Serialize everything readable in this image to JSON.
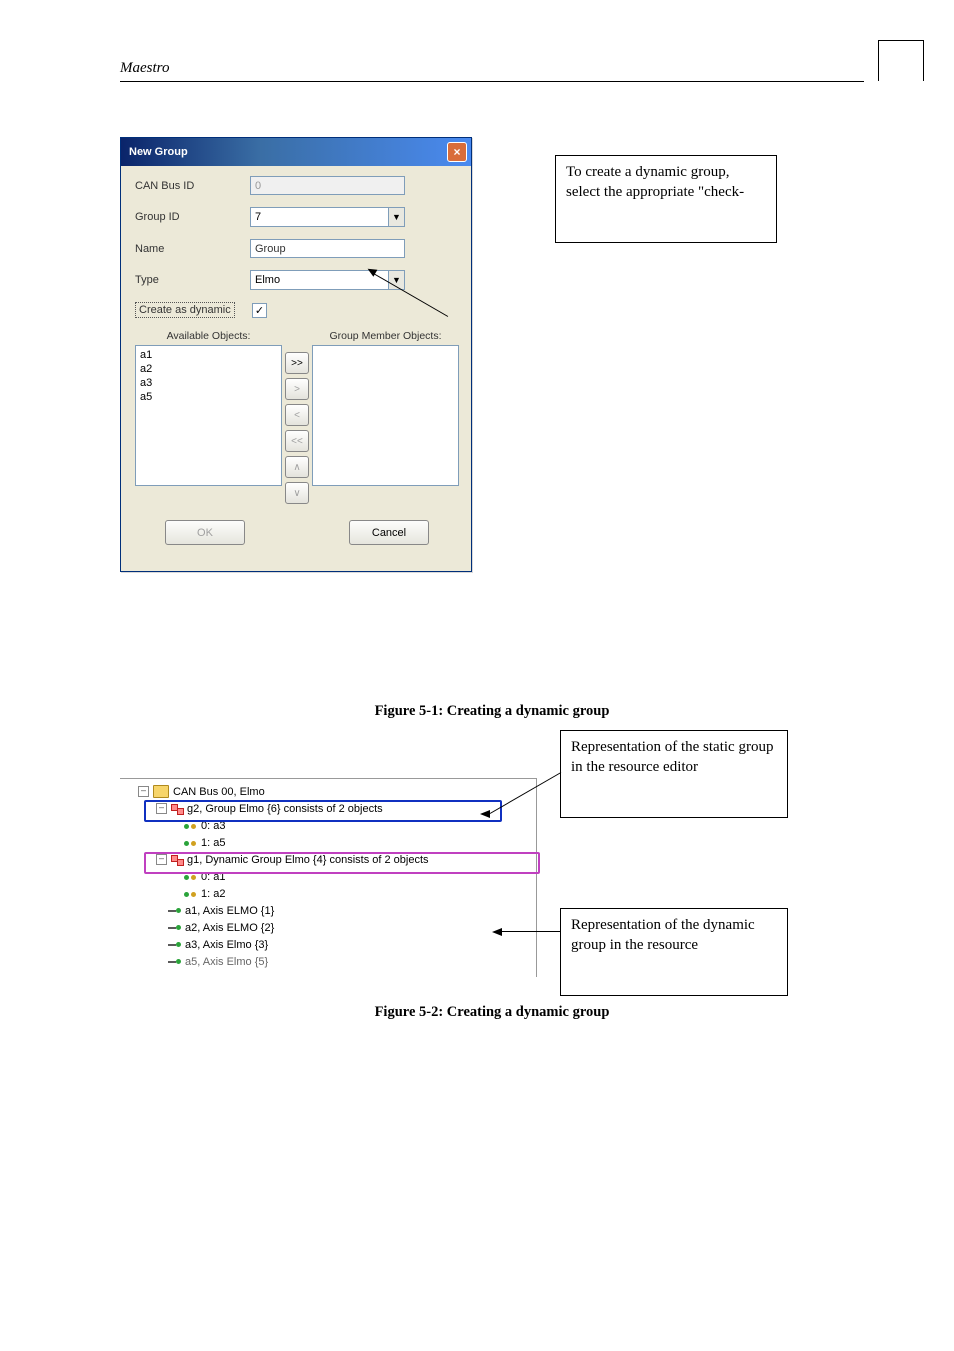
{
  "page_header": "Maestro",
  "dialog": {
    "title": "New Group",
    "fields": {
      "can_bus_id_label": "CAN Bus ID",
      "can_bus_id_value": "0",
      "group_id_label": "Group ID",
      "group_id_value": "7",
      "name_label": "Name",
      "name_value": "Group",
      "type_label": "Type",
      "type_value": "Elmo",
      "create_dynamic_label": "Create as dynamic",
      "create_dynamic_checked": "✓"
    },
    "available_label": "Available Objects:",
    "member_label": "Group Member Objects:",
    "available_items": [
      "a1",
      "a2",
      "a3",
      "a5"
    ],
    "move_buttons": [
      ">>",
      ">",
      "<",
      "<<",
      "∧",
      "∨"
    ],
    "ok_label": "OK",
    "cancel_label": "Cancel"
  },
  "callout1": "To create a dynamic group, select the appropriate \"check-",
  "figure1_caption": "Figure 5-1: Creating a dynamic group",
  "tree": {
    "root": "CAN Bus 00, Elmo",
    "g2": "g2, Group Elmo {6} consists of 2 objects",
    "g2_m0": "0: a3",
    "g2_m1": "1: a5",
    "g1": "g1, Dynamic Group Elmo {4} consists of 2 objects",
    "g1_m0": "0: a1",
    "g1_m1": "1: a2",
    "a1": "a1, Axis ELMO {1}",
    "a2": "a2, Axis ELMO {2}",
    "a3": "a3, Axis Elmo {3}",
    "a5": "a5, Axis Elmo {5}"
  },
  "callout2": "Representation of the static group in the resource editor",
  "callout3": "Representation of the dynamic group in the resource",
  "figure2_caption": "Figure 5-2: Creating a dynamic group"
}
